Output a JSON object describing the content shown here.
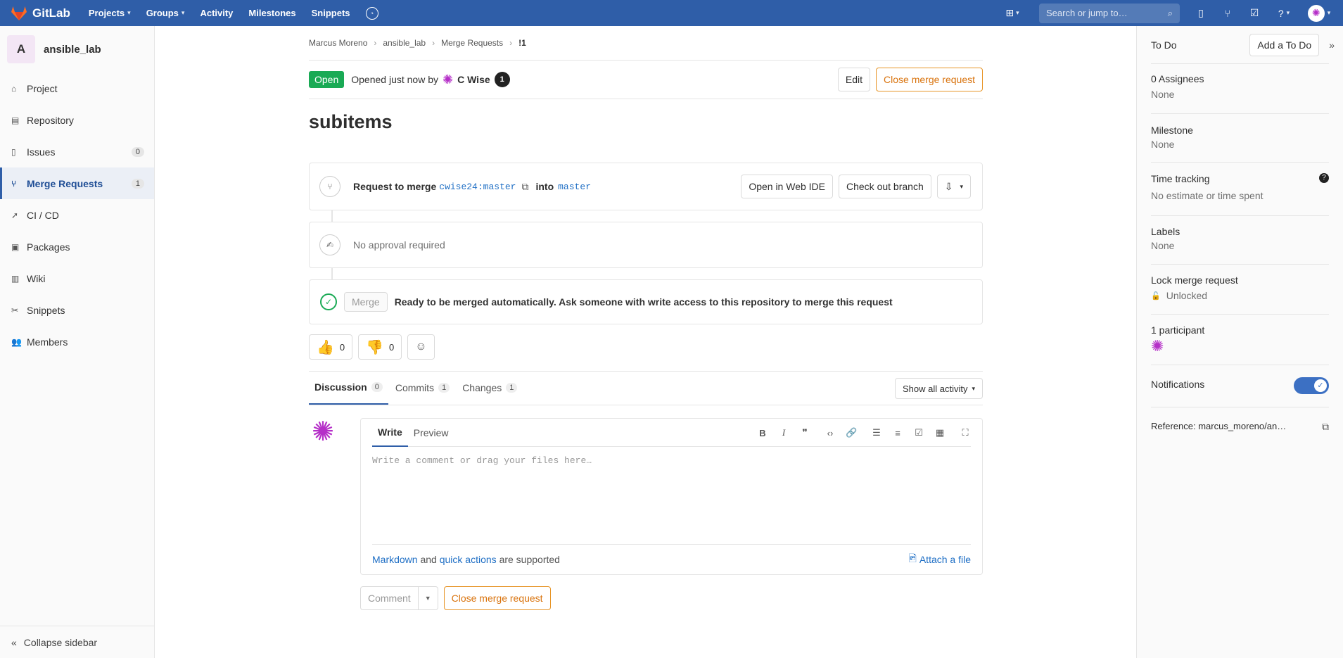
{
  "nav": {
    "brand": "GitLab",
    "links": [
      "Projects",
      "Groups",
      "Activity",
      "Milestones",
      "Snippets"
    ],
    "search_placeholder": "Search or jump to…"
  },
  "sidebar": {
    "project_initial": "A",
    "project_name": "ansible_lab",
    "items": [
      {
        "label": "Project",
        "icon": "home-icon"
      },
      {
        "label": "Repository",
        "icon": "book-icon"
      },
      {
        "label": "Issues",
        "icon": "issues-icon",
        "count": "0"
      },
      {
        "label": "Merge Requests",
        "icon": "merge-request-icon",
        "count": "1"
      },
      {
        "label": "CI / CD",
        "icon": "rocket-icon"
      },
      {
        "label": "Packages",
        "icon": "package-icon"
      },
      {
        "label": "Wiki",
        "icon": "wiki-icon"
      },
      {
        "label": "Snippets",
        "icon": "snippet-icon"
      },
      {
        "label": "Members",
        "icon": "users-icon"
      }
    ],
    "collapse_label": "Collapse sidebar"
  },
  "breadcrumb": [
    "Marcus Moreno",
    "ansible_lab",
    "Merge Requests",
    "!1"
  ],
  "mr": {
    "status": "Open",
    "opened_text": "Opened just now by",
    "author": "C Wise",
    "edit_label": "Edit",
    "close_label": "Close merge request",
    "title": "subitems",
    "request_prefix": "Request to merge",
    "source_branch": "cwise24:master",
    "into": "into",
    "target_branch": "master",
    "open_web_ide": "Open in Web IDE",
    "checkout": "Check out branch",
    "approval": "No approval required",
    "merge_button": "Merge",
    "merge_status": "Ready to be merged automatically. Ask someone with write access to this repository to merge this request",
    "thumbs_up": "0",
    "thumbs_down": "0"
  },
  "tabs": [
    {
      "label": "Discussion",
      "count": "0"
    },
    {
      "label": "Commits",
      "count": "1"
    },
    {
      "label": "Changes",
      "count": "1"
    }
  ],
  "activity_filter": "Show all activity",
  "editor": {
    "write_tab": "Write",
    "preview_tab": "Preview",
    "placeholder": "Write a comment or drag your files here…",
    "markdown": "Markdown",
    "and": "and",
    "quick_actions": "quick actions",
    "supported": "are supported",
    "attach": "Attach a file",
    "comment_button": "Comment",
    "close_button": "Close merge request"
  },
  "right_sidebar": {
    "todo": "To Do",
    "add_todo": "Add a To Do",
    "assignees_label": "0 Assignees",
    "assignees_value": "None",
    "milestone_label": "Milestone",
    "milestone_value": "None",
    "time_label": "Time tracking",
    "time_value": "No estimate or time spent",
    "labels_label": "Labels",
    "labels_value": "None",
    "lock_label": "Lock merge request",
    "lock_value": "Unlocked",
    "participants_label": "1 participant",
    "notifications_label": "Notifications",
    "notifications_enabled": true,
    "reference": "Reference: marcus_moreno/an…"
  },
  "colors": {
    "navbar": "#2f5ea8",
    "open_badge": "#1aaa55",
    "warning": "#e79426",
    "link": "#1f6fc5"
  }
}
